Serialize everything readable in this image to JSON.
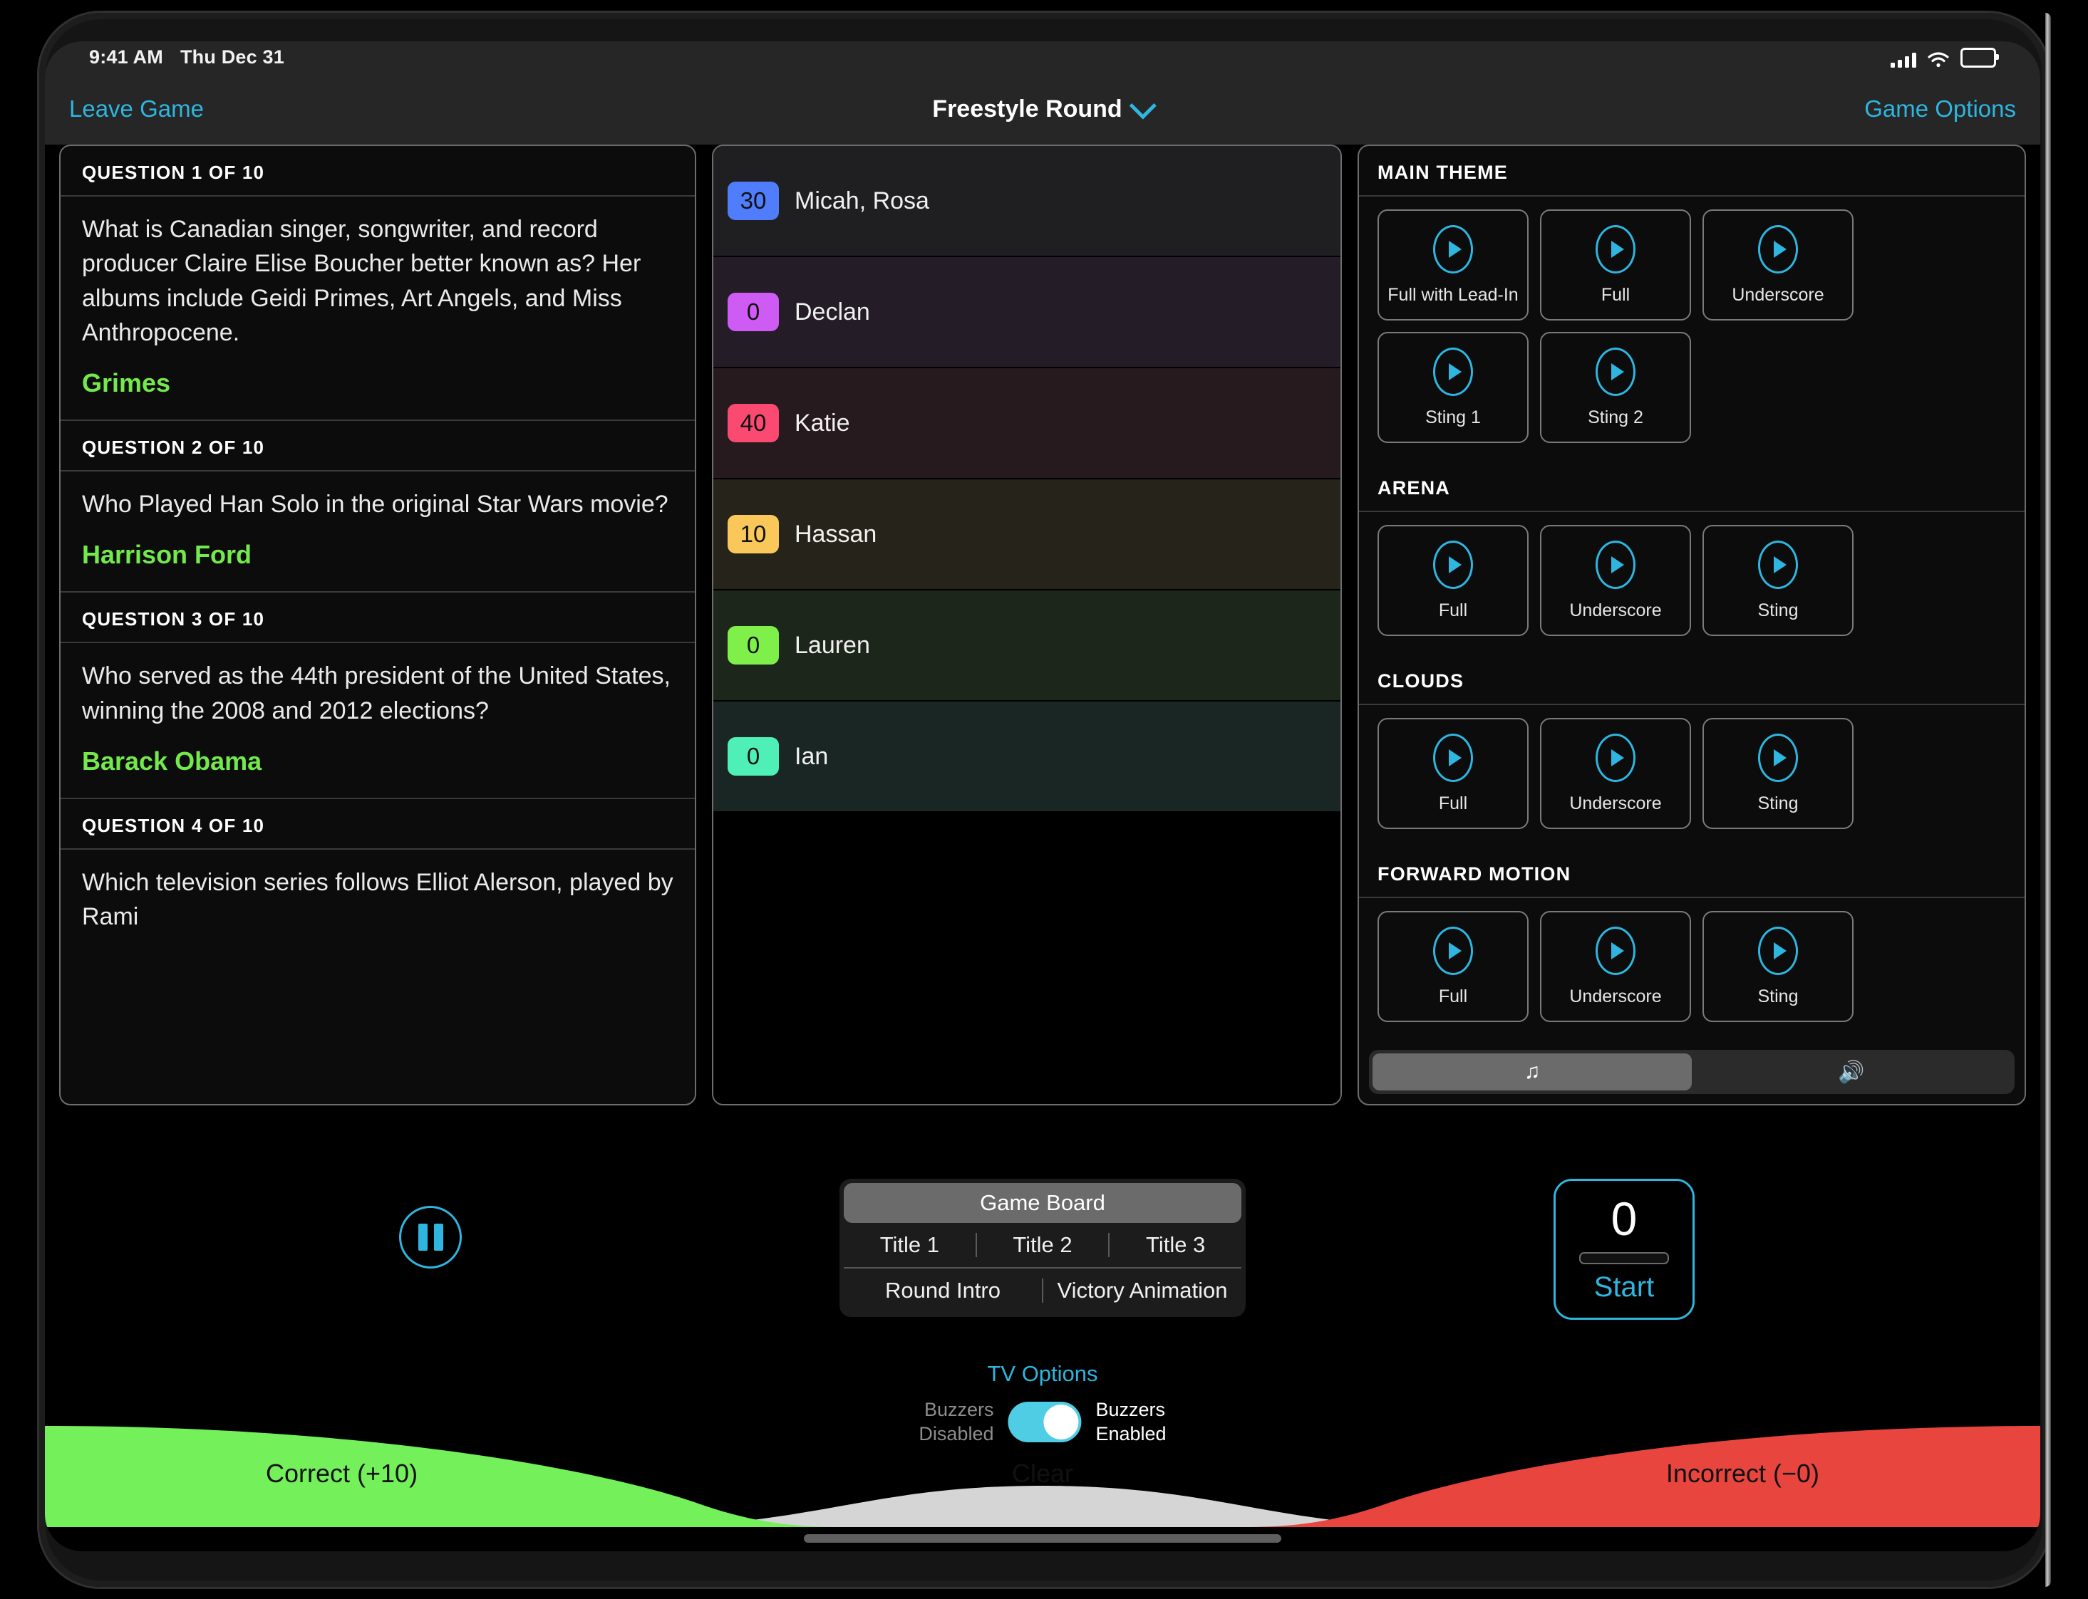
{
  "status": {
    "time": "9:41 AM",
    "date": "Thu Dec 31"
  },
  "nav": {
    "leave": "Leave Game",
    "title": "Freestyle Round",
    "options": "Game Options"
  },
  "questions": [
    {
      "header": "QUESTION 1 OF 10",
      "text": "What is Canadian singer, songwriter, and record producer Claire Elise Boucher better known as? Her albums include Geidi Primes, Art Angels, and Miss Anthropocene.",
      "answer": "Grimes"
    },
    {
      "header": "QUESTION 2 OF 10",
      "text": "Who Played Han Solo in the original Star Wars movie?",
      "answer": "Harrison Ford"
    },
    {
      "header": "QUESTION 3 OF 10",
      "text": "Who served as the 44th president of the United States, winning the 2008 and 2012 elections?",
      "answer": "Barack Obama"
    },
    {
      "header": "QUESTION 4 OF 10",
      "text": "Which television series follows Elliot Alerson, played by Rami",
      "answer": ""
    }
  ],
  "players": [
    {
      "score": "30",
      "name": "Micah, Rosa",
      "color": "#4f7dfb",
      "row": "#1f1f22"
    },
    {
      "score": "0",
      "name": "Declan",
      "color": "#cf5bf5",
      "row": "#241c26"
    },
    {
      "score": "40",
      "name": "Katie",
      "color": "#fa4a72",
      "row": "#261a1e"
    },
    {
      "score": "10",
      "name": "Hassan",
      "color": "#fac85a",
      "row": "#26231a"
    },
    {
      "score": "0",
      "name": "Lauren",
      "color": "#7ff04a",
      "row": "#1d261a"
    },
    {
      "score": "0",
      "name": "Ian",
      "color": "#4ff0b8",
      "row": "#1a2623"
    }
  ],
  "music": {
    "sections": [
      {
        "title": "MAIN THEME",
        "buttons": [
          "Full with Lead-In",
          "Full",
          "Underscore",
          "Sting 1",
          "Sting 2"
        ]
      },
      {
        "title": "ARENA",
        "buttons": [
          "Full",
          "Underscore",
          "Sting"
        ]
      },
      {
        "title": "CLOUDS",
        "buttons": [
          "Full",
          "Underscore",
          "Sting"
        ]
      },
      {
        "title": "FORWARD MOTION",
        "buttons": [
          "Full",
          "Underscore",
          "Sting"
        ]
      }
    ],
    "segments": [
      {
        "icon": "music-note-icon",
        "glyph": "♫",
        "selected": true
      },
      {
        "icon": "speaker-icon",
        "glyph": "🔊",
        "selected": false
      }
    ]
  },
  "transport": {
    "pause": "pause-icon",
    "board_main": "Game Board",
    "titles": [
      "Title 1",
      "Title 2",
      "Title 3"
    ],
    "animations": [
      "Round Intro",
      "Victory Animation"
    ],
    "tv_options": "TV Options",
    "timer_value": "0",
    "start_label": "Start"
  },
  "buzzers": {
    "off_line1": "Buzzers",
    "off_line2": "Disabled",
    "on_line1": "Buzzers",
    "on_line2": "Enabled",
    "enabled": true
  },
  "answerbar": {
    "correct": "Correct (+10)",
    "clear": "Clear",
    "incorrect": "Incorrect (−0)",
    "correct_color": "#73f05a",
    "clear_color": "#d5d5d5",
    "incorrect_color": "#e8453f"
  }
}
